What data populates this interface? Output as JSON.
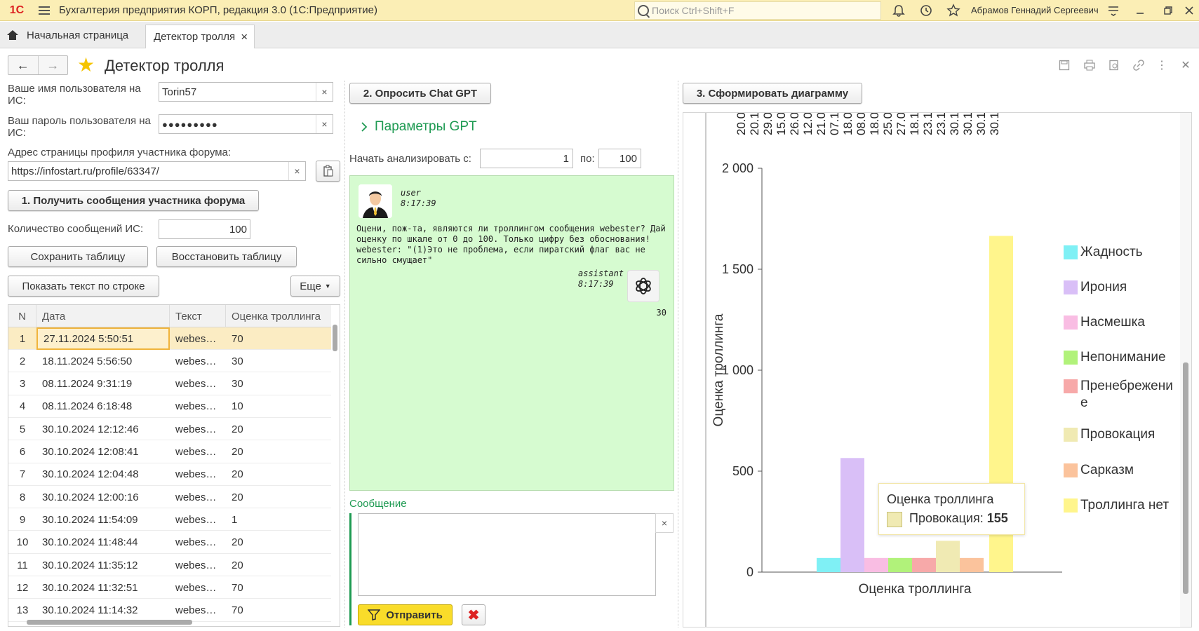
{
  "app": {
    "logo": "1С",
    "title": "Бухгалтерия предприятия КОРП, редакция 3.0  (1С:Предприятие)",
    "search_placeholder": "Поиск Ctrl+Shift+F",
    "user": "Абрамов Геннадий Сергеевич"
  },
  "tabs": {
    "home": "Начальная страница",
    "active": "Детектор тролля",
    "close": "×"
  },
  "page": {
    "title": "Детектор тролля"
  },
  "form": {
    "username_label": "Ваше имя пользователя на ИС:",
    "username_value": "Torin57",
    "password_label": "Ваш пароль пользователя на ИС:",
    "password_value": "●●●●●●●●●",
    "profile_label": "Адрес страницы профиля участника форума:",
    "profile_value": "https://infostart.ru/profile/63347/",
    "get_messages_button": "1. Получить сообщения участника форума",
    "count_label": "Количество сообщений ИС:",
    "count_value": "100",
    "save_table_button": "Сохранить таблицу",
    "restore_table_button": "Восстановить таблицу",
    "show_text_button": "Показать текст по строке",
    "more_button": "Еще",
    "clear": "×"
  },
  "table": {
    "columns": [
      "N",
      "Дата",
      "Текст",
      "Оценка троллинга"
    ],
    "rows": [
      {
        "n": "1",
        "date": "27.11.2024 5:50:51",
        "text": "webes…",
        "score": "70"
      },
      {
        "n": "2",
        "date": "18.11.2024 5:56:50",
        "text": "webes…",
        "score": "30"
      },
      {
        "n": "3",
        "date": "08.11.2024 9:31:19",
        "text": "webes…",
        "score": "30"
      },
      {
        "n": "4",
        "date": "08.11.2024 6:18:48",
        "text": "webes…",
        "score": "10"
      },
      {
        "n": "5",
        "date": "30.10.2024 12:12:46",
        "text": "webes…",
        "score": "20"
      },
      {
        "n": "6",
        "date": "30.10.2024 12:08:41",
        "text": "webes…",
        "score": "20"
      },
      {
        "n": "7",
        "date": "30.10.2024 12:04:48",
        "text": "webes…",
        "score": "20"
      },
      {
        "n": "8",
        "date": "30.10.2024 12:00:16",
        "text": "webes…",
        "score": "20"
      },
      {
        "n": "9",
        "date": "30.10.2024 11:54:09",
        "text": "webes…",
        "score": "1"
      },
      {
        "n": "10",
        "date": "30.10.2024 11:48:44",
        "text": "webes…",
        "score": "20"
      },
      {
        "n": "11",
        "date": "30.10.2024 11:35:12",
        "text": "webes…",
        "score": "20"
      },
      {
        "n": "12",
        "date": "30.10.2024 11:32:51",
        "text": "webes…",
        "score": "70"
      },
      {
        "n": "13",
        "date": "30.10.2024 11:14:32",
        "text": "webes…",
        "score": "70"
      }
    ]
  },
  "gpt": {
    "ask_button": "2. Опросить Chat GPT",
    "params_label": "Параметры GPT",
    "start_label": "Начать анализировать с:",
    "start_value": "1",
    "to_label": "по:",
    "to_value": "100",
    "user_name": "user",
    "user_time": "8:17:39",
    "user_message": "Оцени, пож-та, являются ли троллингом сообщения webester? Дай оценку по шкале от 0 до 100. Только цифру без обоснования! webester: \"(1)Это не проблема, если пиратский флаг вас не сильно смущает\"",
    "assistant_name": "assistant",
    "assistant_time": "8:17:39",
    "assistant_answer": "30",
    "message_label": "Сообщение",
    "send_button": "Отправить",
    "cancel_icon": "✖"
  },
  "chart_button": "3. Сформировать диаграмму",
  "chart_data": {
    "type": "bar",
    "title": "",
    "xlabel": "Оценка троллинга",
    "ylabel": "Оценка троллинга",
    "ylim": [
      0,
      2000
    ],
    "yticks": [
      "0",
      "500",
      "1 000",
      "1 500",
      "2 000"
    ],
    "ytick_values": [
      0,
      500,
      1000,
      1500,
      2000
    ],
    "top_labels": [
      "20.0",
      "20.1",
      "29.0",
      "15.0",
      "26.0",
      "12.0",
      "21.0",
      "07.1",
      "18.0",
      "08.0",
      "18.0",
      "25.0",
      "27.0",
      "18.1",
      "23.1",
      "23.1",
      "30.1",
      "30.1",
      "30.1",
      "30.1"
    ],
    "series": [
      {
        "name": "Жадность",
        "value": 70,
        "color": "#7ff0f5"
      },
      {
        "name": "Ирония",
        "value": 565,
        "color": "#d9bff7"
      },
      {
        "name": "Насмешка",
        "value": 70,
        "color": "#f9bde3"
      },
      {
        "name": "Непонимание",
        "value": 70,
        "color": "#b1f27a"
      },
      {
        "name": "Пренебрежение",
        "value": 70,
        "color": "#f7a9a9"
      },
      {
        "name": "Провокация",
        "value": 155,
        "color": "#f0eab3"
      },
      {
        "name": "Сарказм",
        "value": 70,
        "color": "#fbc39c"
      },
      {
        "name": "Троллинга нет",
        "value": 1665,
        "color": "#fff58c"
      }
    ],
    "legend": "right",
    "tooltip": {
      "title": "Оценка троллинга",
      "series": "Провокация",
      "value": "155"
    }
  }
}
